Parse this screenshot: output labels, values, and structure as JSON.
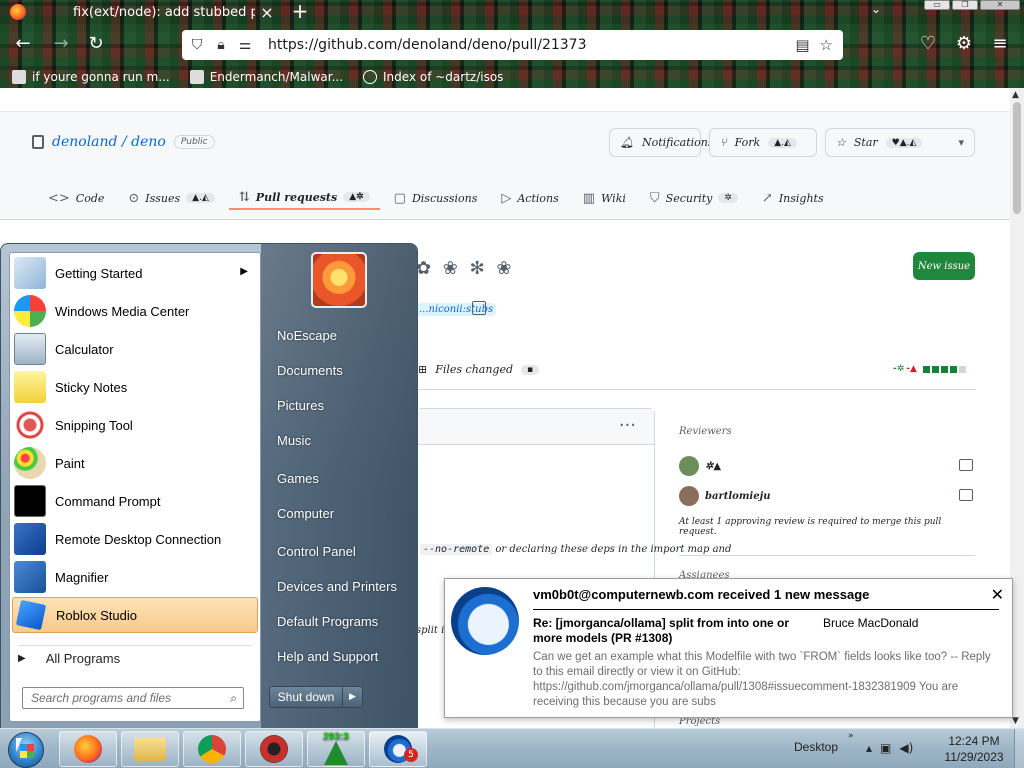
{
  "browser": {
    "tab_title": "fix(ext/node): add stubbed process",
    "tab_close": "×",
    "newtab": "+",
    "tablist": "⌄",
    "win_min": "▭",
    "win_max": "❐",
    "win_close": "✕",
    "back": "←",
    "forward": "→",
    "reload": "↻",
    "url": "https://github.com/denoland/deno/pull/21373",
    "reader": "▤",
    "star": "☆",
    "pocket": "♡",
    "extensions": "⚙",
    "menu": "≡",
    "bookmarks": [
      {
        "label": "if youre gonna run m...",
        "icon": "user-icon"
      },
      {
        "label": "Endermanch/Malwar...",
        "icon": "github-icon"
      },
      {
        "label": "Index of ~dartz/isos",
        "icon": "globe-icon"
      }
    ]
  },
  "github": {
    "repo": "denoland / deno",
    "visibility": "Public",
    "notifications": "Notifications",
    "fork": "Fork",
    "fork_count": "▲.◭",
    "star": "Star",
    "star_count": "♥▲.◭",
    "tabs": [
      {
        "icon": "<>",
        "label": "Code",
        "count": ""
      },
      {
        "icon": "⊙",
        "label": "Issues",
        "count": "▲.◭"
      },
      {
        "icon": "⇅",
        "label": "Pull requests",
        "count": "▲✲"
      },
      {
        "icon": "▢",
        "label": "Discussions",
        "count": ""
      },
      {
        "icon": "▷",
        "label": "Actions",
        "count": ""
      },
      {
        "icon": "▥",
        "label": "Wiki",
        "count": ""
      },
      {
        "icon": "⛉",
        "label": "Security",
        "count": "✲"
      },
      {
        "icon": "↗",
        "label": "Insights",
        "count": ""
      }
    ],
    "pr_number_glyphs": "✿ ❀ ✻ ❀",
    "new_issue": "New issue",
    "branch": "...niconii:stubs",
    "files_changed": "Files changed",
    "files_count": "▪",
    "diff_add": "-✲",
    "diff_del": "-▲",
    "comment_dots": "···",
    "comment_text_code": "--no-remote",
    "comment_text": " or declaring these deps in the import map and",
    "comment_text2": "split in,",
    "sidebar_reviewers": "Reviewers",
    "reviewers": [
      {
        "name": "✲▲"
      },
      {
        "name": "bartlomieju"
      }
    ],
    "review_note": "At least 1 approving review is required to merge this pull request.",
    "sidebar_assignees": "Assignees",
    "sidebar_projects": "Projects"
  },
  "startmenu": {
    "programs": [
      {
        "label": "Getting Started",
        "icon": "getting-started-icon",
        "submenu": true
      },
      {
        "label": "Windows Media Center",
        "icon": "media-center-icon"
      },
      {
        "label": "Calculator",
        "icon": "calculator-icon"
      },
      {
        "label": "Sticky Notes",
        "icon": "sticky-notes-icon"
      },
      {
        "label": "Snipping Tool",
        "icon": "snipping-tool-icon"
      },
      {
        "label": "Paint",
        "icon": "paint-icon"
      },
      {
        "label": "Command Prompt",
        "icon": "command-prompt-icon"
      },
      {
        "label": "Remote Desktop Connection",
        "icon": "remote-desktop-icon"
      },
      {
        "label": "Magnifier",
        "icon": "magnifier-icon"
      },
      {
        "label": "Roblox Studio",
        "icon": "roblox-studio-icon"
      }
    ],
    "all_programs": "All Programs",
    "search_placeholder": "Search programs and files",
    "right_links": [
      "NoEscape",
      "Documents",
      "Pictures",
      "Music",
      "Games",
      "Computer",
      "Control Panel",
      "Devices and Printers",
      "Default Programs",
      "Help and Support"
    ],
    "shutdown": "Shut down",
    "shutdown_arrow": "▶"
  },
  "notification": {
    "title": "vm0b0t@computernewb.com received 1 new message",
    "close": "✕",
    "subject": "Re: [jmorganca/ollama] split from into one or more models (PR #1308)",
    "sender": "Bruce MacDonald",
    "body": "Can we get an example what this Modelfile with two `FROM` fields looks like too? -- Reply to this email directly or view it on GitHub: https://github.com/jmorganca/ollama/pull/1308#issuecomment-1832381909 You are receiving this because you are subs"
  },
  "taskbar": {
    "counter": "293:3",
    "thunderbird_badge": "5",
    "desktop": "Desktop",
    "desktop_chevron": "»",
    "tray_up": "▴",
    "tray_network": "▣",
    "tray_volume": "◀)",
    "time": "12:24 PM",
    "date": "11/29/2023"
  },
  "colors": {
    "accent_green": "#1f883d",
    "link_blue": "#0969da",
    "hover_orange": "#f9c98a"
  }
}
